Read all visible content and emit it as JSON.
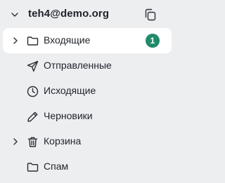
{
  "account": {
    "email": "teh4@demo.org",
    "expand_icon": "chevron-down-icon",
    "copy_icon": "copy-icon"
  },
  "folders": [
    {
      "label": "Входящие",
      "icon": "folder-icon",
      "has_children": true,
      "active": true,
      "unread": "1"
    },
    {
      "label": "Отправленные",
      "icon": "send-icon",
      "has_children": false
    },
    {
      "label": "Исходящие",
      "icon": "clock-icon",
      "has_children": false
    },
    {
      "label": "Черновики",
      "icon": "pencil-icon",
      "has_children": false
    },
    {
      "label": "Корзина",
      "icon": "trash-icon",
      "has_children": true
    },
    {
      "label": "Спам",
      "icon": "folder-icon",
      "has_children": false
    }
  ],
  "colors": {
    "background": "#eceef0",
    "active_item": "#ffffff",
    "badge": "#218a6a",
    "text": "#1f2329"
  }
}
